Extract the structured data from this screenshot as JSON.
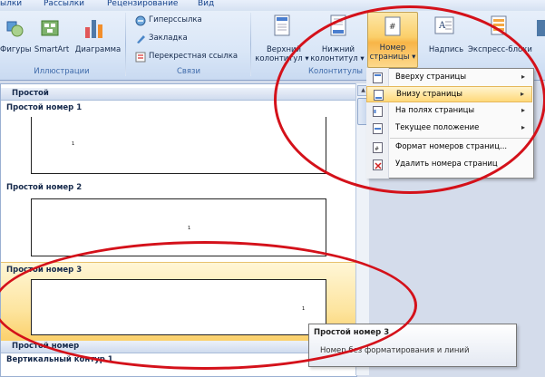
{
  "tabs": [
    "ылки",
    "Рассылки",
    "Рецензирование",
    "Вид"
  ],
  "ribbon": {
    "illustrations": {
      "label": "Иллюстрации",
      "shapes": "Фигуры",
      "smartart": "SmartArt",
      "chart": "Диаграмма"
    },
    "links": {
      "label": "Связи",
      "hyperlink": "Гиперссылка",
      "bookmark": "Закладка",
      "cross_ref": "Перекрестная ссылка"
    },
    "header_footer": {
      "label": "Колонтитулы",
      "header_l1": "Верхний",
      "header_l2": "колонтитул",
      "footer_l1": "Нижний",
      "footer_l2": "колонтитул",
      "page_num_l1": "Номер",
      "page_num_l2": "страницы"
    },
    "text": {
      "textbox": "Надпись",
      "quickparts": "Экспресс-блоки"
    }
  },
  "gallery": {
    "category_top": "Простой",
    "items": [
      {
        "title": "Простой номер 1",
        "num": "1"
      },
      {
        "title": "Простой номер 2",
        "num": "1"
      },
      {
        "title": "Простой номер 3",
        "num": "1"
      }
    ],
    "category_bottom": "Простой номер",
    "next_item": "Вертикальный контур 1"
  },
  "menu": {
    "items": [
      {
        "label": "Вверху страницы",
        "arrow": "▸"
      },
      {
        "label": "Внизу страницы",
        "arrow": "▸"
      },
      {
        "label": "На полях страницы",
        "arrow": "▸"
      },
      {
        "label": "Текущее положение",
        "arrow": "▸"
      },
      {
        "label": "Формат номеров страниц...",
        "arrow": ""
      },
      {
        "label": "Удалить номера страниц",
        "arrow": ""
      }
    ]
  },
  "tooltip": {
    "title": "Простой номер 3",
    "description": "Номер без форматирования и линий"
  },
  "colors": {
    "annotation_red": "#d4111a",
    "highlight": "#ffd97a",
    "ribbon_text": "#15428b"
  }
}
